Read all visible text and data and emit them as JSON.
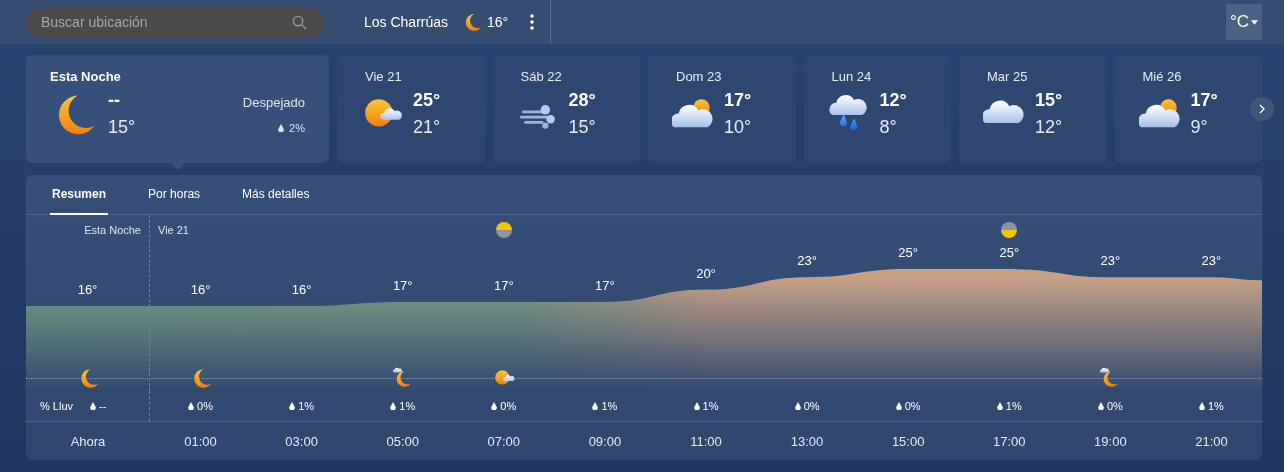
{
  "search": {
    "placeholder": "Buscar ubicación"
  },
  "location": {
    "name": "Los Charrúas",
    "kind": "moon",
    "temp": "16°"
  },
  "unit": {
    "label": "°C"
  },
  "today": {
    "title": "Esta Noche",
    "kind": "moon",
    "high": "--",
    "low": "15°",
    "condition": "Despejado",
    "rain": "2%"
  },
  "days": [
    {
      "label": "Vie 21",
      "kind": "sun-cloud",
      "high": "25°",
      "low": "21°"
    },
    {
      "label": "Sáb 22",
      "kind": "wind",
      "high": "28°",
      "low": "15°"
    },
    {
      "label": "Dom 23",
      "kind": "cloud-sun",
      "high": "17°",
      "low": "10°"
    },
    {
      "label": "Lun 24",
      "kind": "rain",
      "high": "12°",
      "low": "8°"
    },
    {
      "label": "Mar 25",
      "kind": "cloud",
      "high": "15°",
      "low": "12°"
    },
    {
      "label": "Mié 26",
      "kind": "cloud-sun",
      "high": "17°",
      "low": "9°"
    }
  ],
  "tabs": [
    {
      "label": "Resumen",
      "selected": true
    },
    {
      "label": "Por horas",
      "selected": false
    },
    {
      "label": "Más detalles",
      "selected": false
    }
  ],
  "chart_labels": [
    "Esta Noche",
    "Vie 21"
  ],
  "rain_label": "% Lluv",
  "hours": [
    {
      "time": "Ahora",
      "temp": "16°",
      "rain": "--",
      "kind": "moon"
    },
    {
      "time": "01:00",
      "temp": "16°",
      "rain": "0%",
      "kind": "moon"
    },
    {
      "time": "03:00",
      "temp": "16°",
      "rain": "1%"
    },
    {
      "time": "05:00",
      "temp": "17°",
      "rain": "1%",
      "kind": "moon-cloud"
    },
    {
      "time": "07:00",
      "temp": "17°",
      "rain": "0%",
      "kind": "sun-cloud",
      "marker": {
        "kind": "sunrise"
      }
    },
    {
      "time": "09:00",
      "temp": "17°",
      "rain": "1%"
    },
    {
      "time": "11:00",
      "temp": "20°",
      "rain": "1%"
    },
    {
      "time": "13:00",
      "temp": "23°",
      "rain": "0%"
    },
    {
      "time": "15:00",
      "temp": "25°",
      "rain": "0%"
    },
    {
      "time": "17:00",
      "temp": "25°",
      "rain": "1%",
      "marker": {
        "kind": "sunset"
      }
    },
    {
      "time": "19:00",
      "temp": "23°",
      "rain": "0%",
      "kind": "moon-cloud"
    },
    {
      "time": "21:00",
      "temp": "23°",
      "rain": "1%"
    }
  ]
}
